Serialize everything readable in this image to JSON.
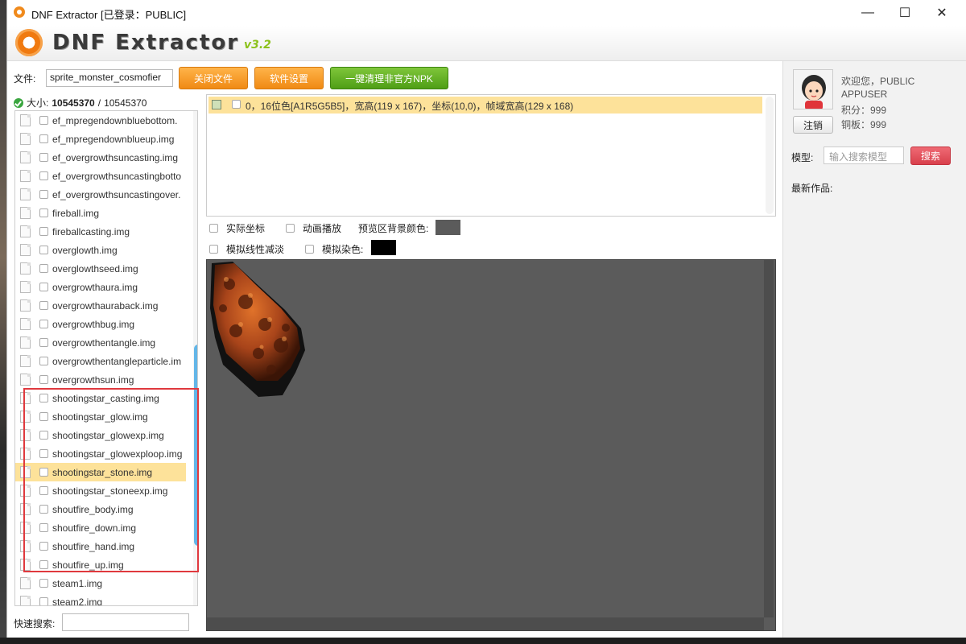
{
  "titlebar": {
    "title": "DNF Extractor [已登录：PUBLIC]",
    "minimize": "—",
    "maximize": "☐",
    "close": "✕"
  },
  "header": {
    "logo_text": "DNF Extractor",
    "version": "v3.2"
  },
  "toolbar": {
    "file_label": "文件:",
    "file_value": "sprite_monster_cosmofier",
    "close_file": "关闭文件",
    "settings": "软件设置",
    "cleanup": "一键清理非官方NPK"
  },
  "size": {
    "label": "大小:",
    "current": "10545370",
    "sep": "/",
    "total": "10545370"
  },
  "file_list": {
    "items": [
      {
        "label": "ef_mpregendownbluebottom.",
        "selected": false
      },
      {
        "label": "ef_mpregendownblueup.img",
        "selected": false
      },
      {
        "label": "ef_overgrowthsuncasting.img",
        "selected": false
      },
      {
        "label": "ef_overgrowthsuncastingbotto",
        "selected": false
      },
      {
        "label": "ef_overgrowthsuncastingover.",
        "selected": false
      },
      {
        "label": "fireball.img",
        "selected": false
      },
      {
        "label": "fireballcasting.img",
        "selected": false
      },
      {
        "label": "overglowth.img",
        "selected": false
      },
      {
        "label": "overglowthseed.img",
        "selected": false
      },
      {
        "label": "overgrowthaura.img",
        "selected": false
      },
      {
        "label": "overgrowthauraback.img",
        "selected": false
      },
      {
        "label": "overgrowthbug.img",
        "selected": false
      },
      {
        "label": "overgrowthentangle.img",
        "selected": false
      },
      {
        "label": "overgrowthentangleparticle.im",
        "selected": false
      },
      {
        "label": "overgrowthsun.img",
        "selected": false
      },
      {
        "label": "shootingstar_casting.img",
        "selected": false
      },
      {
        "label": "shootingstar_glow.img",
        "selected": false
      },
      {
        "label": "shootingstar_glowexp.img",
        "selected": false
      },
      {
        "label": "shootingstar_glowexploop.img",
        "selected": false
      },
      {
        "label": "shootingstar_stone.img",
        "selected": true
      },
      {
        "label": "shootingstar_stoneexp.img",
        "selected": false
      },
      {
        "label": "shoutfire_body.img",
        "selected": false
      },
      {
        "label": "shoutfire_down.img",
        "selected": false
      },
      {
        "label": "shoutfire_hand.img",
        "selected": false
      },
      {
        "label": "shoutfire_up.img",
        "selected": false
      },
      {
        "label": "steam1.img",
        "selected": false
      },
      {
        "label": "steam2.img",
        "selected": false
      }
    ]
  },
  "quick_search": {
    "label": "快速搜索:",
    "value": ""
  },
  "frames": {
    "rows": [
      {
        "text": "0，16位色[A1R5G5B5]，宽高(119 x 167)，坐标(10,0)，帧域宽高(129 x 168)"
      }
    ]
  },
  "options": {
    "actual_coords": "实际坐标",
    "animation": "动画播放",
    "bg_color_label": "预览区背景颜色:",
    "bg_color": "#5b5b5b",
    "linear_fade": "模拟线性减淡",
    "dye_label": "模拟染色:",
    "dye_color": "#000000"
  },
  "user": {
    "welcome": "欢迎您，PUBLIC",
    "name": "APPUSER",
    "points": "积分：999",
    "copper": "铜板：999",
    "logout": "注销"
  },
  "model_search": {
    "label": "模型:",
    "placeholder": "输入搜索模型",
    "button": "搜索"
  },
  "latest": {
    "label": "最新作品:"
  },
  "colors": {
    "accent_orange": "#f08a14",
    "accent_green": "#4f9e16",
    "selection": "#fde29a",
    "highlight_box": "#e0393e",
    "search_red": "#d8404c"
  }
}
